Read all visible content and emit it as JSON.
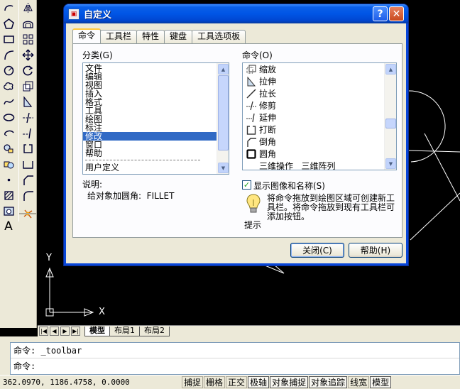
{
  "dialog": {
    "title": "自定义",
    "tabs": [
      "命令",
      "工具栏",
      "特性",
      "键盘",
      "工具选项板"
    ],
    "categories_label": "分类(G)",
    "categories": [
      "文件",
      "编辑",
      "视图",
      "插入",
      "格式",
      "工具",
      "绘图",
      "标注",
      "修改",
      "窗口",
      "帮助",
      "用户定义"
    ],
    "selected_category": "修改",
    "commands_label": "命令(O)",
    "commands": [
      "缩放",
      "拉伸",
      "拉长",
      "修剪",
      "延伸",
      "打断",
      "倒角",
      "圆角",
      "三维操作   三维阵列"
    ],
    "description_label": "说明:",
    "description": "给对象加圆角:  FILLET",
    "show_icons_label": "显示图像和名称(S)",
    "show_icons_checked": true,
    "tip_text": "将命令拖放到绘图区域可创建新工具栏。将命令拖放到现有工具栏可添加按钮。",
    "tip_label": "提示",
    "close_button": "关闭(C)",
    "help_button": "帮助(H)"
  },
  "layout_tabs": [
    "模型",
    "布局1",
    "布局2"
  ],
  "active_layout": "模型",
  "command_lines": [
    "命令: _toolbar",
    "命令:"
  ],
  "axis": {
    "y": "Y",
    "x": "X"
  },
  "status": {
    "coordinates": "362.0970,  1186.4758, 0.0000",
    "buttons": [
      {
        "label": "捕捉",
        "pressed": false
      },
      {
        "label": "栅格",
        "pressed": false
      },
      {
        "label": "正交",
        "pressed": false
      },
      {
        "label": "极轴",
        "pressed": true
      },
      {
        "label": "对象捕捉",
        "pressed": true
      },
      {
        "label": "对象追踪",
        "pressed": true
      },
      {
        "label": "线宽",
        "pressed": false
      },
      {
        "label": "模型",
        "pressed": true
      }
    ]
  },
  "text_tool_glyph": "A",
  "colors": {
    "titlebar": "#0055e5",
    "selection": "#316ac5",
    "canvas": "#000000",
    "face": "#ece9d8"
  }
}
